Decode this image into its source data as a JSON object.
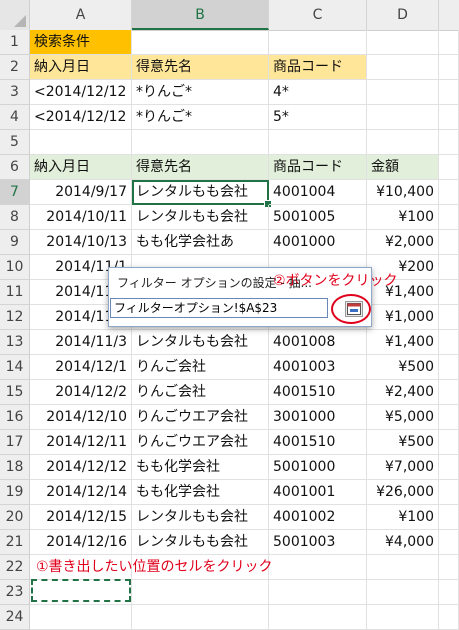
{
  "columns": [
    "A",
    "B",
    "C",
    "D"
  ],
  "selected_column": "B",
  "rows": [
    {
      "n": "1",
      "a": "検索条件",
      "b": "",
      "c": "",
      "d": ""
    },
    {
      "n": "2",
      "a": "納入月日",
      "b": "得意先名",
      "c": "商品コード",
      "d": ""
    },
    {
      "n": "3",
      "a": "<2014/12/12",
      "b": "*りんご*",
      "c": "4*",
      "d": ""
    },
    {
      "n": "4",
      "a": "<2014/12/12",
      "b": "*りんご*",
      "c": "5*",
      "d": ""
    },
    {
      "n": "5",
      "a": "",
      "b": "",
      "c": "",
      "d": ""
    },
    {
      "n": "6",
      "a": "納入月日",
      "b": "得意先名",
      "c": "商品コード",
      "d": "金額"
    },
    {
      "n": "7",
      "a": "2014/9/17",
      "b": "レンタルもも会社",
      "c": "4001004",
      "d": "¥10,400"
    },
    {
      "n": "8",
      "a": "2014/10/11",
      "b": "レンタルもも会社",
      "c": "5001005",
      "d": "¥100"
    },
    {
      "n": "9",
      "a": "2014/10/13",
      "b": "もも化学会社あ",
      "c": "4001000",
      "d": "¥2,000"
    },
    {
      "n": "10",
      "a": "2014/11/1",
      "b": "",
      "c": "",
      "d": "¥200"
    },
    {
      "n": "11",
      "a": "2014/11/1",
      "b": "",
      "c": "",
      "d": "¥1,400"
    },
    {
      "n": "12",
      "a": "2014/11/1",
      "b": "",
      "c": "",
      "d": "¥1,000"
    },
    {
      "n": "13",
      "a": "2014/11/3",
      "b": "レンタルもも会社",
      "c": "4001008",
      "d": "¥1,400"
    },
    {
      "n": "14",
      "a": "2014/12/1",
      "b": "りんご会社",
      "c": "4001003",
      "d": "¥500"
    },
    {
      "n": "15",
      "a": "2014/12/2",
      "b": "りんご会社",
      "c": "4001510",
      "d": "¥2,400"
    },
    {
      "n": "16",
      "a": "2014/12/10",
      "b": "りんごウエア会社",
      "c": "3001000",
      "d": "¥5,000"
    },
    {
      "n": "17",
      "a": "2014/12/11",
      "b": "りんごウエア会社",
      "c": "4001510",
      "d": "¥500"
    },
    {
      "n": "18",
      "a": "2014/12/12",
      "b": "もも化学会社",
      "c": "5001000",
      "d": "¥7,000"
    },
    {
      "n": "19",
      "a": "2014/12/14",
      "b": "もも化学会社",
      "c": "4001001",
      "d": "¥26,000"
    },
    {
      "n": "20",
      "a": "2014/12/15",
      "b": "レンタルもも会社",
      "c": "4001002",
      "d": "¥100"
    },
    {
      "n": "21",
      "a": "2014/12/16",
      "b": "レンタルもも会社",
      "c": "5001003",
      "d": "¥4,000"
    },
    {
      "n": "22",
      "a": "",
      "b": "",
      "c": "",
      "d": ""
    },
    {
      "n": "23",
      "a": "",
      "b": "",
      "c": "",
      "d": ""
    },
    {
      "n": "24",
      "a": "",
      "b": "",
      "c": "",
      "d": ""
    }
  ],
  "annotations": {
    "step1": "①書き出したい位置のセルをクリック",
    "step2": "②ボタンをクリック"
  },
  "dialog": {
    "title": "フィルター オプションの設定 - 抽...",
    "value": "フィルターオプション!$A$23",
    "button_icon": "collapse-expand-icon"
  },
  "colors": {
    "criteria_header": "#ffc000",
    "criteria_labels": "#ffe699",
    "list_header": "#e2efda",
    "accent_green": "#217346",
    "annotation_red": "#e0001b"
  }
}
